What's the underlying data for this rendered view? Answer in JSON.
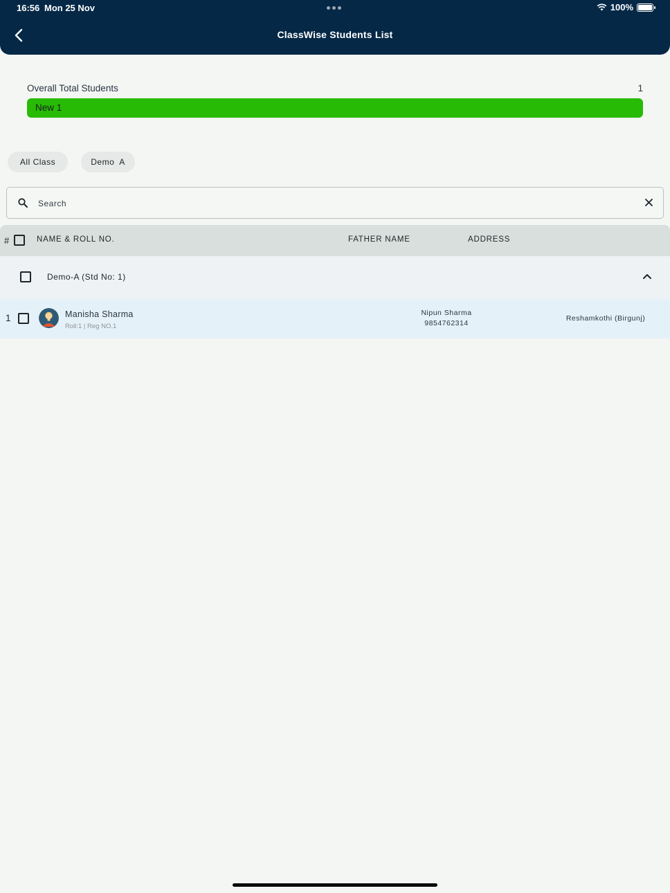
{
  "status_bar": {
    "time": "16:56",
    "date": "Mon 25 Nov",
    "battery": "100%",
    "battery_level": 1.0,
    "icons": [
      "wifi-icon",
      "battery-icon"
    ]
  },
  "header": {
    "title": "ClassWise Students List",
    "back_icon": "chevron-left-icon",
    "background": "#052846"
  },
  "summary": {
    "overall_label": "Overall Total Students",
    "overall_count": "1",
    "new_label": "New 1",
    "new_fraction": 1.0,
    "new_color": "#27bb05"
  },
  "filters": {
    "chips": [
      "All Class",
      "Demo  A"
    ]
  },
  "search": {
    "placeholder": "Search",
    "value": "",
    "search_icon": "search-icon",
    "clear_icon": "close-icon"
  },
  "table": {
    "columns": {
      "index": "#",
      "name": "NAME & ROLL NO.",
      "father": "FATHER NAME",
      "address": "ADDRESS"
    },
    "groups": [
      {
        "label": "Demo-A (Std No: 1)",
        "expanded": true,
        "students": [
          {
            "index": "1",
            "name": "Manisha Sharma",
            "sub": "Roll:1 | Reg NO.1",
            "father_name": "Nipun Sharma",
            "father_phone": "9854762314",
            "address": "Reshamkothi (Birgunj)",
            "avatar_icon": "user-avatar-icon"
          }
        ]
      }
    ]
  },
  "colors": {
    "header_bg": "#052846",
    "table_header_bg": "#d9dfdc",
    "group_bg": "#eef2f5",
    "row_bg": "#e5f1f9",
    "page_bg": "#f4f6f4"
  }
}
